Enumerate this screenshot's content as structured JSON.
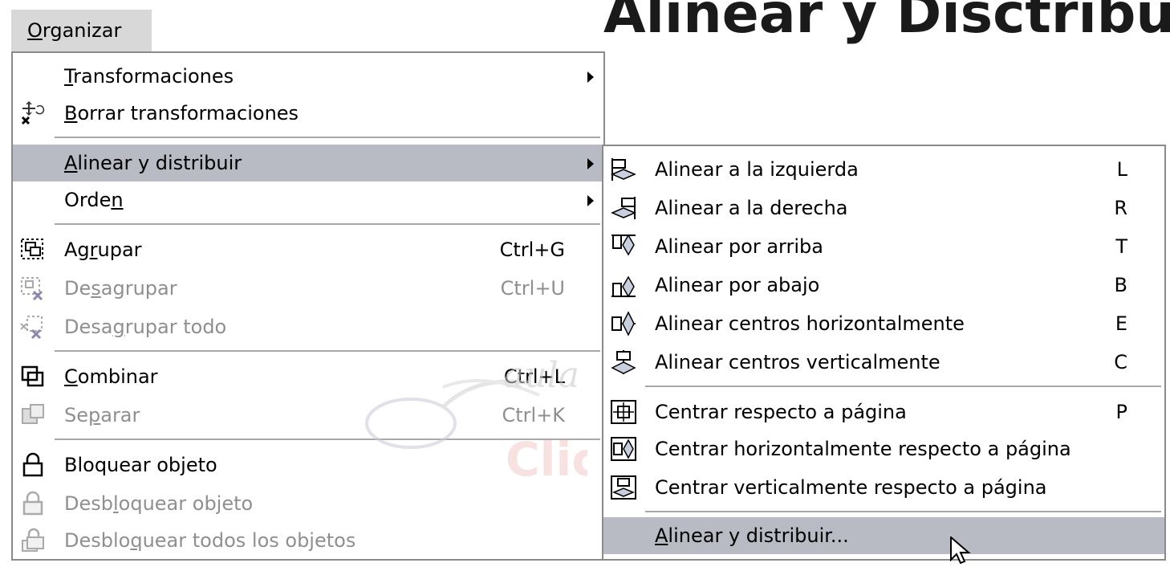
{
  "page_title": "Alinear y Disctribuir",
  "menubar": {
    "label": "Organizar"
  },
  "menu": {
    "items": [
      {
        "label": "Transformaciones",
        "shortcut": "",
        "icon": ""
      },
      {
        "label": "Borrar transformaciones",
        "shortcut": "",
        "icon": "clear-transformations-icon"
      },
      {
        "label": "Alinear y distribuir",
        "shortcut": "",
        "icon": ""
      },
      {
        "label": "Orden",
        "shortcut": "",
        "icon": ""
      },
      {
        "label": "Agrupar",
        "shortcut": "Ctrl+G",
        "icon": "group-icon"
      },
      {
        "label": "Desagrupar",
        "shortcut": "Ctrl+U",
        "icon": "ungroup-icon"
      },
      {
        "label": "Desagrupar todo",
        "shortcut": "",
        "icon": "ungroup-all-icon"
      },
      {
        "label": "Combinar",
        "shortcut": "Ctrl+L",
        "icon": "combine-icon"
      },
      {
        "label": "Separar",
        "shortcut": "Ctrl+K",
        "icon": "break-apart-icon"
      },
      {
        "label": "Bloquear objeto",
        "shortcut": "",
        "icon": "lock-icon"
      },
      {
        "label": "Desbloquear objeto",
        "shortcut": "",
        "icon": "unlock-icon"
      },
      {
        "label": "Desbloquear todos los objetos",
        "shortcut": "",
        "icon": "unlock-all-icon"
      }
    ]
  },
  "submenu": {
    "items": [
      {
        "label": "Alinear a la izquierda",
        "shortcut": "L",
        "icon": "align-left-icon"
      },
      {
        "label": "Alinear a la derecha",
        "shortcut": "R",
        "icon": "align-right-icon"
      },
      {
        "label": "Alinear por arriba",
        "shortcut": "T",
        "icon": "align-top-icon"
      },
      {
        "label": "Alinear por abajo",
        "shortcut": "B",
        "icon": "align-bottom-icon"
      },
      {
        "label": "Alinear centros horizontalmente",
        "shortcut": "E",
        "icon": "align-horizontal-centers-icon"
      },
      {
        "label": "Alinear centros verticalmente",
        "shortcut": "C",
        "icon": "align-vertical-centers-icon"
      },
      {
        "label": "Centrar respecto a página",
        "shortcut": "P",
        "icon": "center-to-page-icon"
      },
      {
        "label": "Centrar horizontalmente respecto a página",
        "shortcut": "",
        "icon": "center-horizontally-page-icon"
      },
      {
        "label": "Centrar verticalmente respecto a página",
        "shortcut": "",
        "icon": "center-vertically-page-icon"
      },
      {
        "label": "Alinear y distribuir...",
        "shortcut": "",
        "icon": ""
      }
    ]
  },
  "watermark": {
    "line1": "aula",
    "line2": "Clic"
  }
}
